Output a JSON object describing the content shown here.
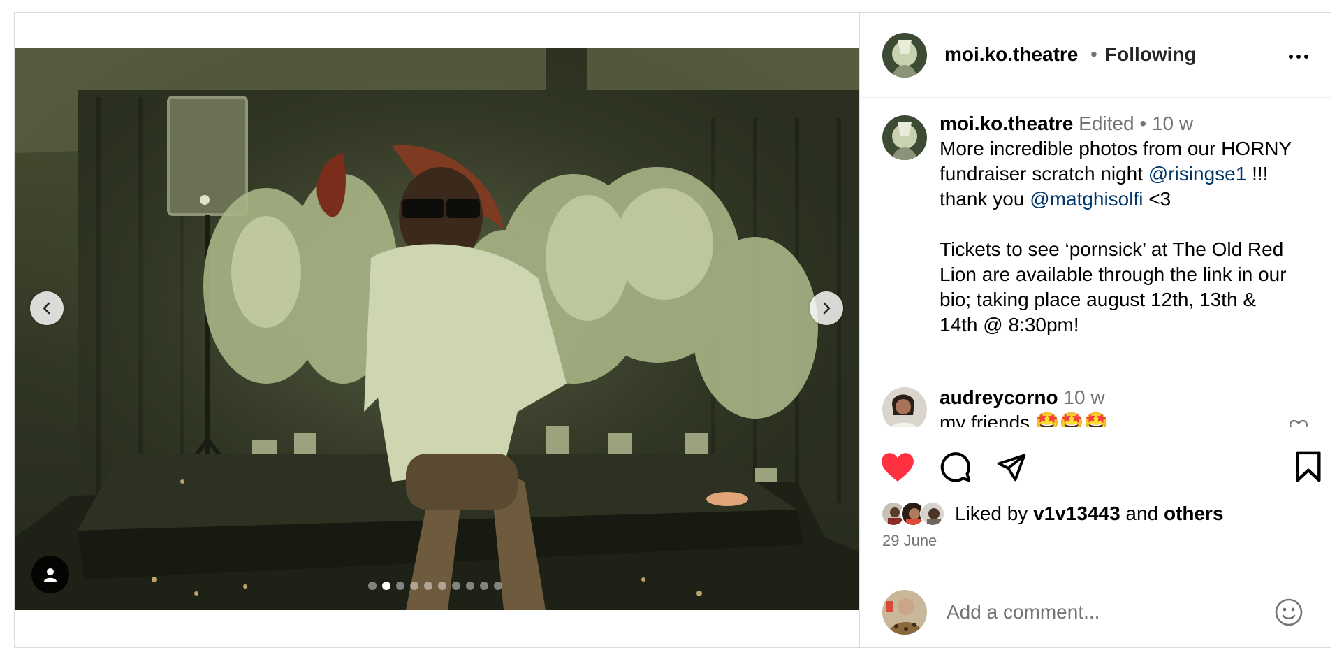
{
  "post": {
    "username": "moi.ko.theatre",
    "follow_dot": "•",
    "follow_status": "Following",
    "more_icon": "more-horizontal-icon",
    "carousel": {
      "total_slides": 10,
      "active_index": 1,
      "prev_icon": "chevron-left-icon",
      "next_icon": "chevron-right-icon",
      "tag_icon": "user-tag-icon"
    },
    "caption": {
      "username": "moi.ko.theatre",
      "edited": "Edited",
      "dot": "•",
      "time": "10 w",
      "line1": "More incredible photos from our HORNY",
      "line2_pre": "fundraiser scratch night ",
      "line2_mention": "@risingse1",
      "line2_post": " !!!",
      "line3_pre": "thank you ",
      "line3_mention": "@matghisolfi",
      "line3_post": " <3",
      "line5": "Tickets to see ‘pornsick’ at The Old Red",
      "line6": "Lion are available through the link in our",
      "line7": "bio; taking place august 12th, 13th &",
      "line8": "14th @ 8:30pm!"
    },
    "comments": [
      {
        "username": "audreycorno",
        "time": "10 w",
        "text": "my friends 🤩🤩🤩"
      }
    ],
    "actions": {
      "liked": true,
      "like_color": "#ff3040"
    },
    "likes": {
      "prefix": "Liked by ",
      "user": "v1v13443",
      "middle": " and ",
      "others": "others"
    },
    "date": "29 June",
    "add_comment": {
      "placeholder": "Add a comment..."
    },
    "colors": {
      "mention": "#00376b",
      "secondary_text": "#737373",
      "border": "#dbdbdb"
    }
  }
}
